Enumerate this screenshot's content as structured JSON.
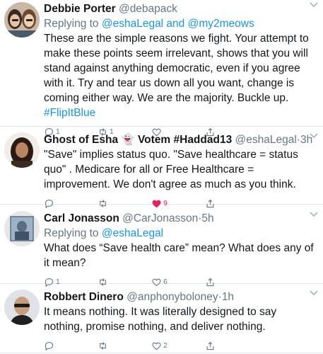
{
  "tweets": [
    {
      "name": "Debbie Porter",
      "handle": "@debapack",
      "time": "",
      "replying_prefix": "Replying to",
      "replying_to": "@eshaLegal and @my2meows",
      "text": "These are the simple reasons we fight. Your attempt to make these points seem irrelevant, shows that you will stand against anything democratic, even if you agree with it. Try and tear us down all you want, change is coming either way. We are the majority. Buckle up.",
      "hashtag": "#FlipItBlue",
      "replies": "1",
      "retweets": "1",
      "likes": "",
      "liked": false
    },
    {
      "name": "Ghost of Esha 👻 Votem #Haddad13",
      "handle": "@eshaLegal",
      "time": "3h",
      "replying_prefix": "",
      "replying_to": "",
      "text": "\"Save\" implies status quo.   \"Save healthcare = status quo\" . Medicare for all or Free Healthcare = improvement. We don't agree as much as you think.",
      "hashtag": "",
      "replies": "",
      "retweets": "",
      "likes": "9",
      "liked": true
    },
    {
      "name": "Carl Jonasson",
      "handle": "@CarJonasson",
      "time": "5h",
      "replying_prefix": "Replying to",
      "replying_to": "@eshaLegal",
      "text": "What does “Save health care” mean? What does any of it mean?",
      "hashtag": "",
      "replies": "1",
      "retweets": "",
      "likes": "6",
      "liked": false
    },
    {
      "name": "Robbert Dinero",
      "handle": "@anphonyboloney",
      "time": "1h",
      "replying_prefix": "",
      "replying_to": "",
      "text": "It means nothing. It was literally designed to say nothing, promise nothing, and deliver nothing.",
      "hashtag": "",
      "replies": "",
      "retweets": "",
      "likes": "2",
      "liked": false
    }
  ],
  "icons": {
    "reply": "reply-icon",
    "retweet": "retweet-icon",
    "like": "heart-icon",
    "share": "share-icon",
    "menu": "chevron-down-icon"
  },
  "colors": {
    "link": "#1b95e0",
    "muted": "#657786",
    "like_active": "#e0245e",
    "divider": "#e1e8ed"
  }
}
